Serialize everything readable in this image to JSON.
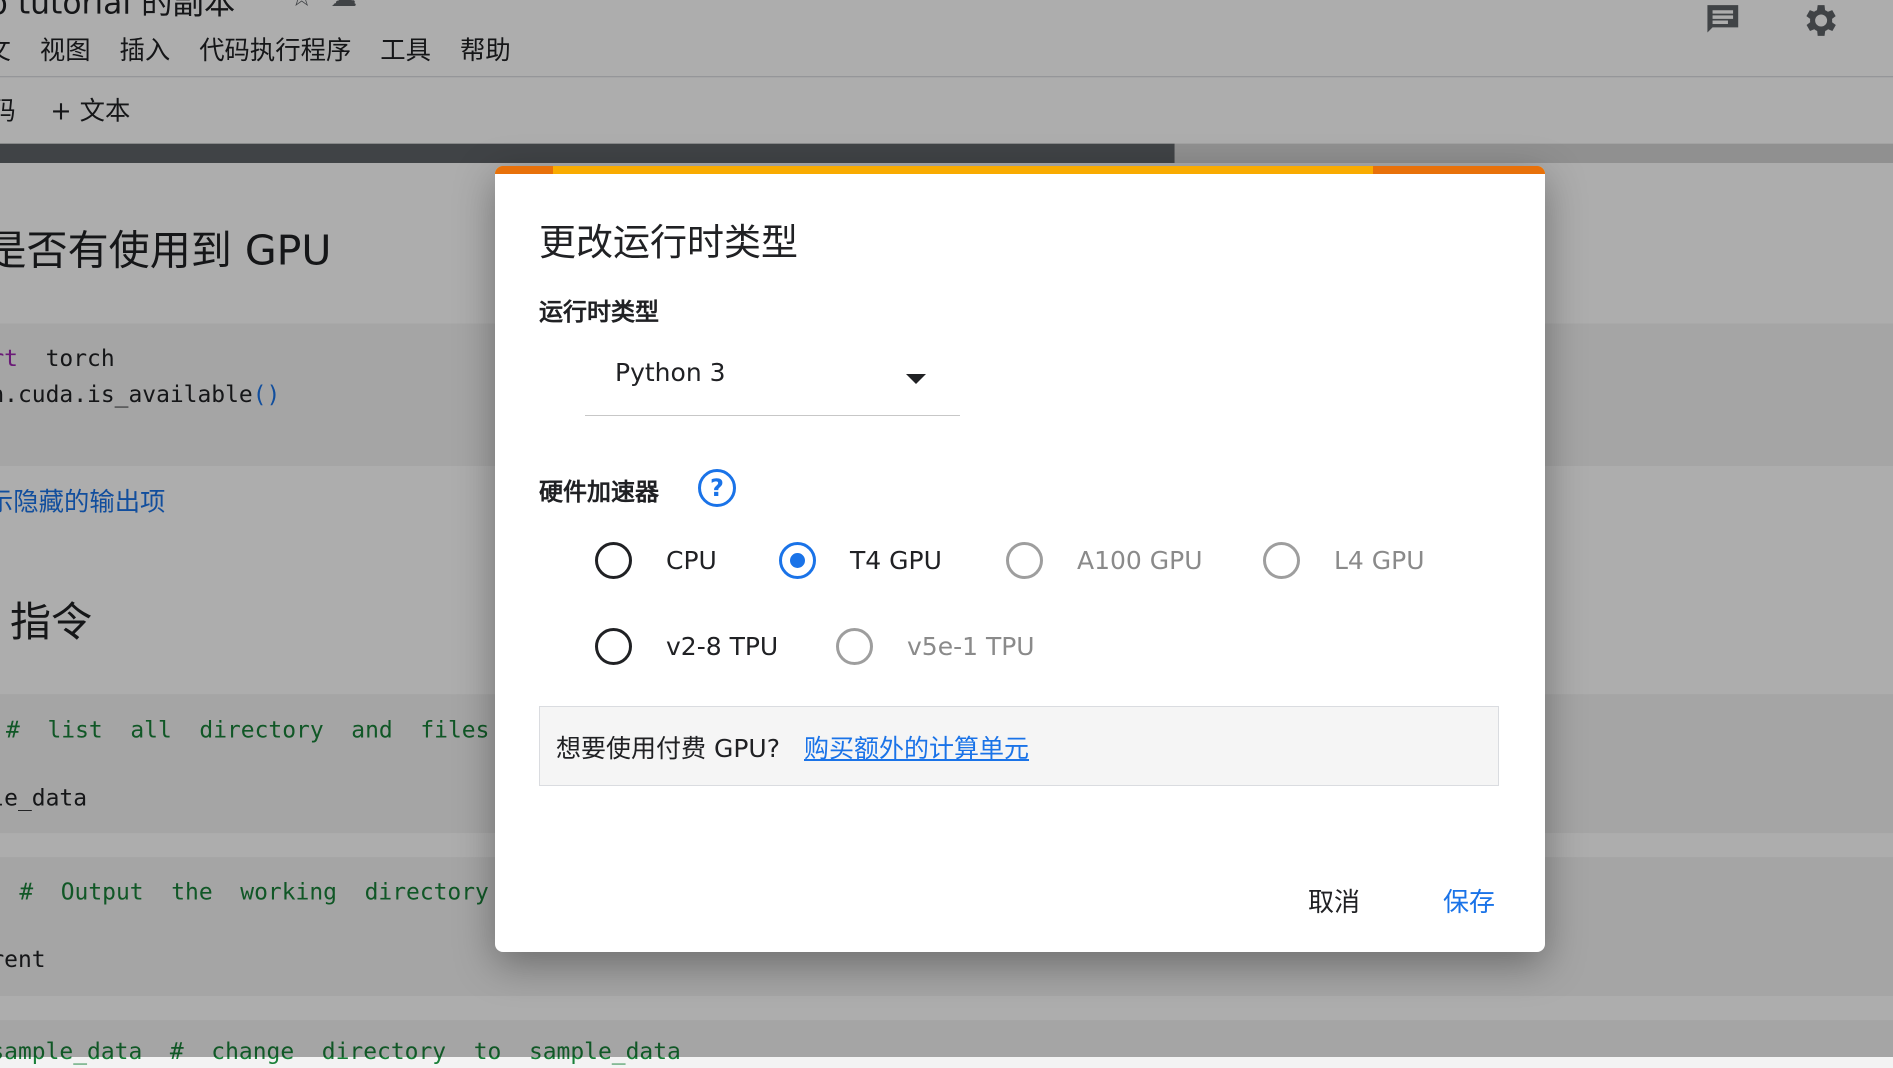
{
  "app": {
    "title_fragment": "b tutorial 的副本",
    "menu": [
      "文",
      "视图",
      "插入",
      "代码执行程序",
      "工具",
      "帮助"
    ],
    "toolbar": {
      "code_fragment": "码",
      "add_text": "+ 文本"
    },
    "icons": {
      "comment": "comment-icon",
      "settings": "gear-icon"
    }
  },
  "notebook": {
    "heading_gpu": "是否有使用到 GPU",
    "code1": {
      "line1_kw": "rt",
      "line1_rest": "  torch",
      "line2": "h.cuda.is_available",
      "line2_paren": "()"
    },
    "hidden_output_link": "示隐藏的输出项",
    "heading_cmd": "l 指令",
    "code2": {
      "comment": "#  list  all  directory  and  files",
      "line2": "le_data"
    },
    "code3": {
      "comment": "#  Output  the  working  directory",
      "line2": "rent"
    },
    "code4": {
      "line1": "sample_data  #  change  directory  to  sample_data"
    }
  },
  "dialog": {
    "title": "更改运行时类型",
    "runtime_label": "运行时类型",
    "runtime_value": "Python 3",
    "accelerator_label": "硬件加速器",
    "help_symbol": "?",
    "options": [
      {
        "label": "CPU",
        "checked": false,
        "disabled": false
      },
      {
        "label": "T4 GPU",
        "checked": true,
        "disabled": false
      },
      {
        "label": "A100 GPU",
        "checked": false,
        "disabled": true
      },
      {
        "label": "L4 GPU",
        "checked": false,
        "disabled": true
      },
      {
        "label": "v2-8 TPU",
        "checked": false,
        "disabled": false
      },
      {
        "label": "v5e-1 TPU",
        "checked": false,
        "disabled": true
      }
    ],
    "info_text": "想要使用付费 GPU?",
    "info_link": "购买额外的计算单元",
    "cancel": "取消",
    "save": "保存",
    "colors": {
      "accent": "#1a73e8",
      "bar_orange": "#f9ab00",
      "bar_dark_orange": "#e8710a"
    }
  }
}
